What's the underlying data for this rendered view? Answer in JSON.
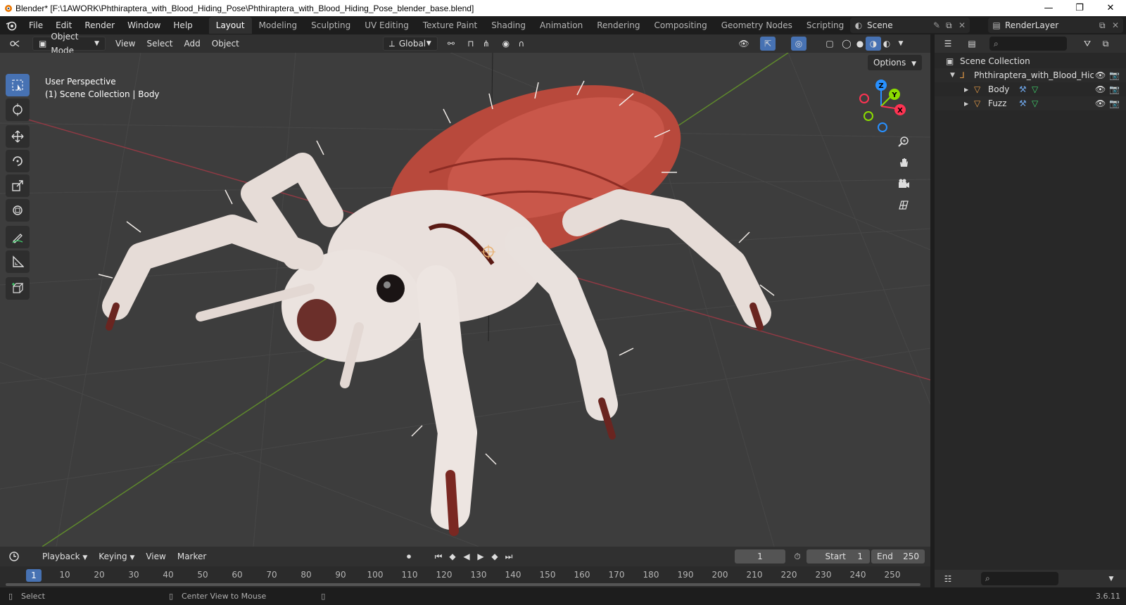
{
  "window": {
    "title": "Blender* [F:\\1AWORK\\Phthiraptera_with_Blood_Hiding_Pose\\Phthiraptera_with_Blood_Hiding_Pose_blender_base.blend]",
    "minimize": "—",
    "maximize": "❐",
    "close": "✕"
  },
  "menu": [
    "File",
    "Edit",
    "Render",
    "Window",
    "Help"
  ],
  "workspaces": [
    "Layout",
    "Modeling",
    "Sculpting",
    "UV Editing",
    "Texture Paint",
    "Shading",
    "Animation",
    "Rendering",
    "Compositing",
    "Geometry Nodes",
    "Scripting"
  ],
  "workspace_add": "+",
  "scene": {
    "label": "Scene",
    "render_layer": "RenderLayer"
  },
  "viewport_header": {
    "mode": "Object Mode",
    "menus": [
      "View",
      "Select",
      "Add",
      "Object"
    ],
    "transform_orientation": "Global",
    "options_label": "Options"
  },
  "viewport": {
    "perspective": "User Perspective",
    "collection_info": "(1) Scene Collection | Body",
    "gizmo_axes": {
      "z": "Z",
      "y": "Y",
      "x": "X"
    }
  },
  "outliner": {
    "root": "Scene Collection",
    "collection": "Phthiraptera_with_Blood_Hic",
    "objects": [
      "Body",
      "Fuzz"
    ]
  },
  "timeline": {
    "menus": [
      "Playback",
      "Keying",
      "View",
      "Marker"
    ],
    "current_frame": "1",
    "start_label": "Start",
    "start": "1",
    "end_label": "End",
    "end": "250",
    "ruler_marks": [
      "1",
      "10",
      "20",
      "30",
      "40",
      "50",
      "60",
      "70",
      "80",
      "90",
      "100",
      "110",
      "120",
      "130",
      "140",
      "150",
      "160",
      "170",
      "180",
      "190",
      "200",
      "210",
      "220",
      "230",
      "240",
      "250"
    ]
  },
  "status": {
    "select": "Select",
    "center_view": "Center View to Mouse",
    "version": "3.6.11"
  },
  "colors": {
    "accent": "#4772b3",
    "x_axis": "#ff3352",
    "y_axis": "#8bdc00",
    "z_axis": "#2890ff",
    "object_orange": "#e59b46"
  }
}
